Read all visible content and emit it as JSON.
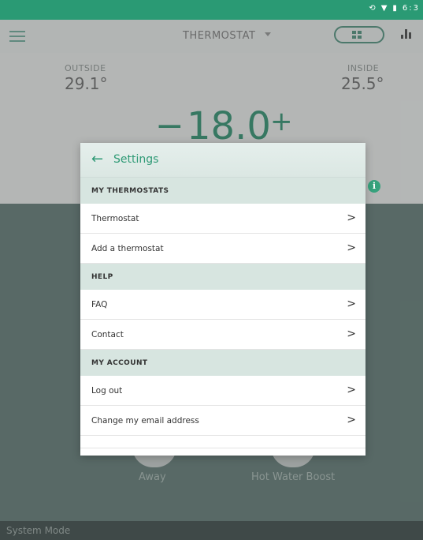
{
  "status_bar": {
    "time": "6:3"
  },
  "topbar": {
    "title": "THERMOSTAT"
  },
  "readings": {
    "outside_label": "OUTSIDE",
    "outside_value": "29.1°",
    "inside_label": "INSIDE",
    "inside_value": "25.5°"
  },
  "setpoint": {
    "minus": "−",
    "value": "18.0",
    "plus": "+"
  },
  "bottom": {
    "away_label": "Away",
    "hot_water_label": "Hot Water Boost",
    "system_mode_label": "System Mode"
  },
  "dialog": {
    "back": "←",
    "title": "Settings",
    "sections": [
      {
        "header": "MY THERMOSTATS",
        "items": [
          "Thermostat",
          "Add a thermostat"
        ]
      },
      {
        "header": "HELP",
        "items": [
          "FAQ",
          "Contact"
        ]
      },
      {
        "header": "MY ACCOUNT",
        "items": [
          "Log out",
          "Change my email address"
        ]
      }
    ]
  },
  "colors": {
    "accent": "#2f9a76",
    "statusbar": "#2a9a74",
    "section": "#d7e5e0"
  }
}
